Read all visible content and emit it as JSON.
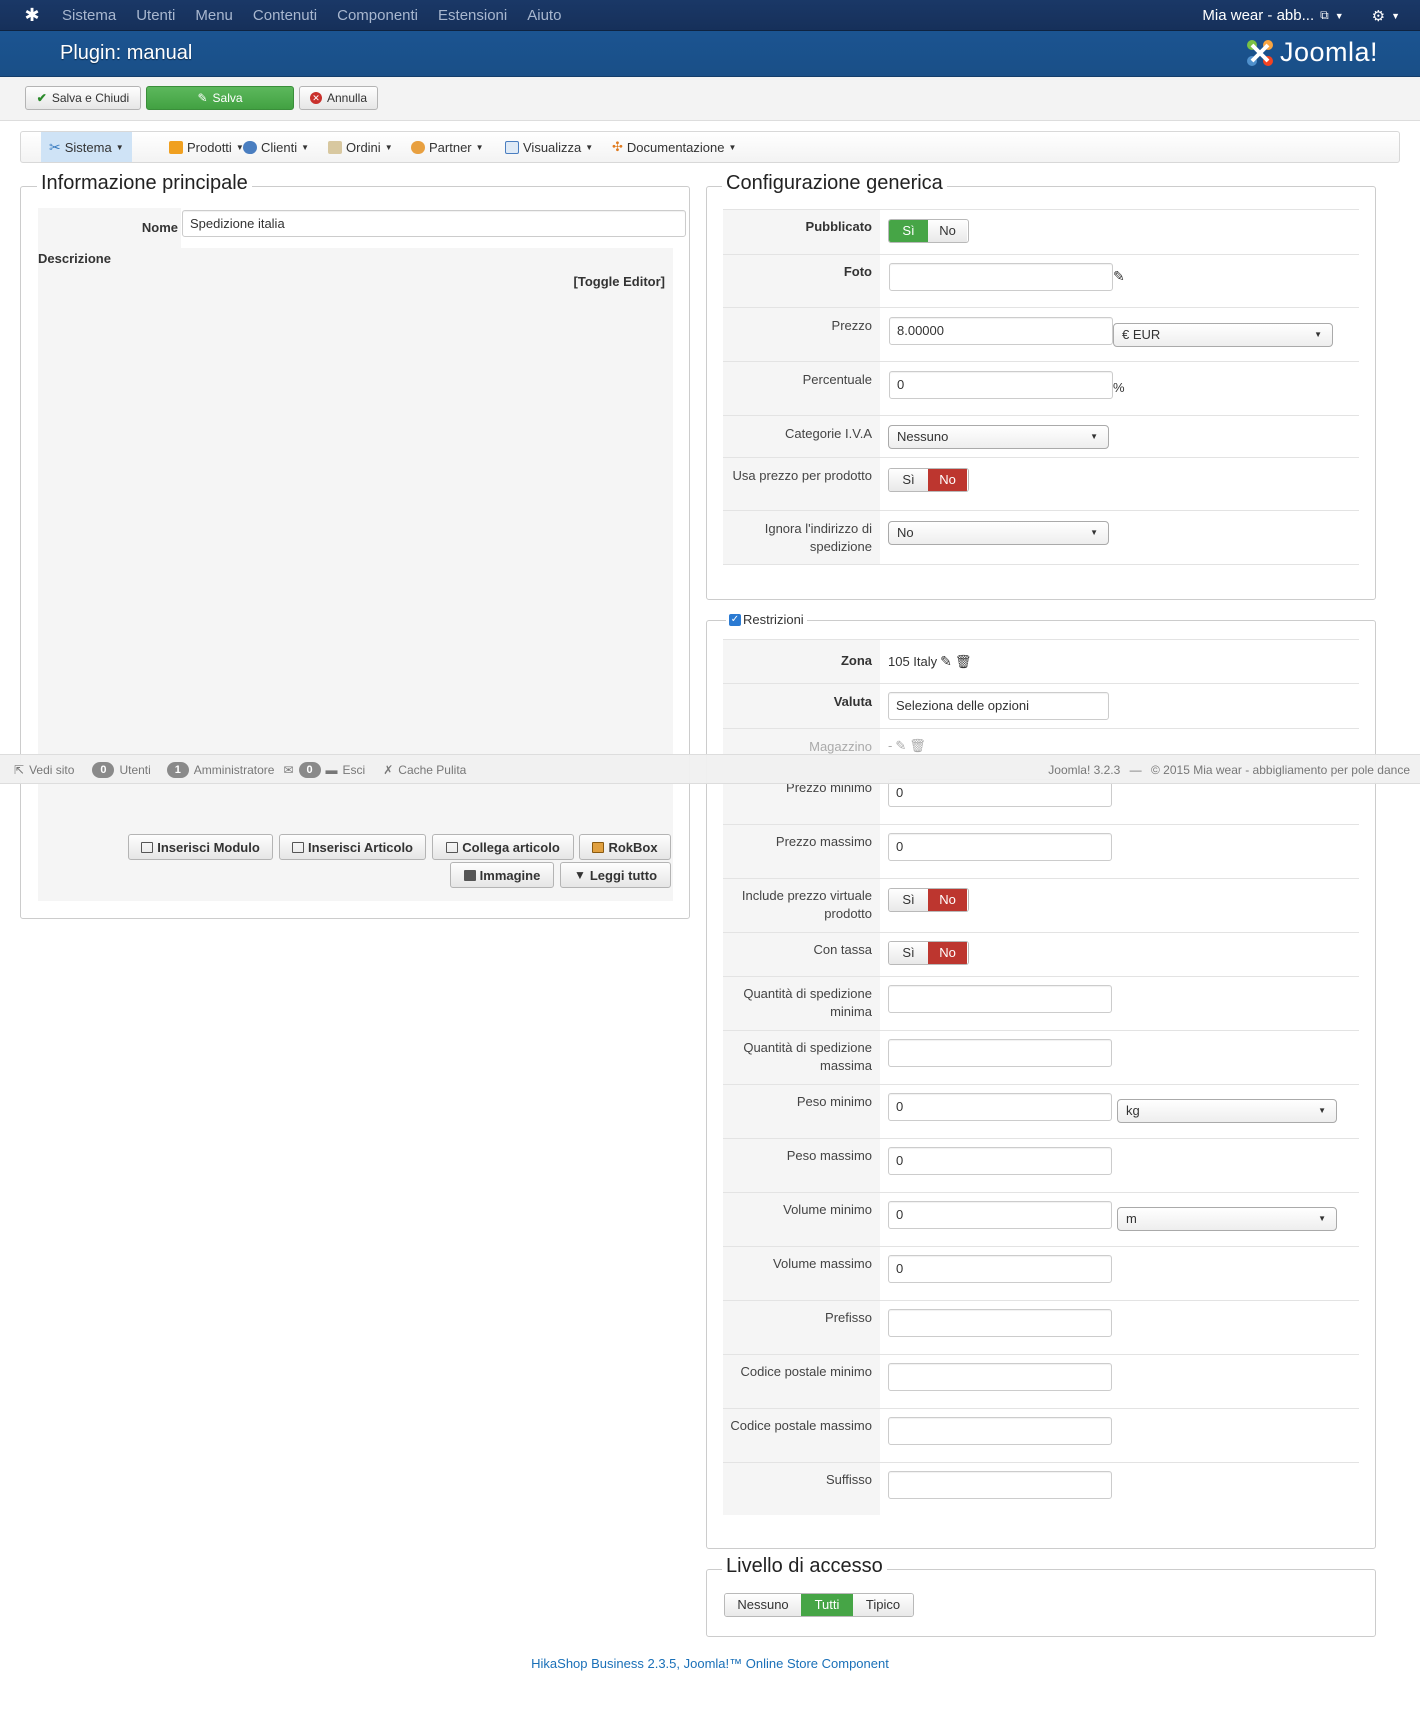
{
  "topbar": {
    "menu": [
      "Sistema",
      "Utenti",
      "Menu",
      "Contenuti",
      "Componenti",
      "Estensioni",
      "Aiuto"
    ],
    "site_name": "Mia wear - abb...",
    "logo_icon": "joomla-icon",
    "gear_icon": "gear-icon"
  },
  "titlebar": {
    "title": "Plugin: manual",
    "brand": "Joomla!"
  },
  "toolbar": {
    "save_close": "Salva e Chiudi",
    "save": "Salva",
    "cancel": "Annulla"
  },
  "hikamenu": [
    "Sistema",
    "Prodotti",
    "Clienti",
    "Ordini",
    "Partner",
    "Visualizza",
    "Documentazione"
  ],
  "main": {
    "legend": "Informazione principale",
    "name_label": "Nome",
    "name_value": "Spedizione italia",
    "description_label": "Descrizione",
    "toggle_editor": "[Toggle Editor]",
    "editor_buttons": [
      "Inserisci Modulo",
      "Inserisci Articolo",
      "Collega articolo",
      "RokBox",
      "Immagine",
      "Leggi tutto"
    ]
  },
  "config": {
    "legend": "Configurazione generica",
    "published_label": "Pubblicato",
    "yes": "Sì",
    "no": "No",
    "photo_label": "Foto",
    "price_label": "Prezzo",
    "price_value": "8.00000",
    "currency": "€ EUR",
    "percent_label": "Percentuale",
    "percent_value": "0",
    "percent_sign": "%",
    "vat_label": "Categorie I.V.A",
    "vat_value": "Nessuno",
    "per_product_label": "Usa prezzo per prodotto",
    "ignore_addr_label": "Ignora l'indirizzo di spedizione",
    "ignore_addr_value": "No"
  },
  "restrictions": {
    "legend": "Restrizioni",
    "zone_label": "Zona",
    "zone_value": "105 Italy",
    "currency_label": "Valuta",
    "currency_placeholder": "Seleziona delle opzioni",
    "warehouse_label": "Magazzino",
    "warehouse_value": "-",
    "rows": [
      {
        "label": "Prezzo minimo",
        "value": "0"
      },
      {
        "label": "Prezzo massimo",
        "value": "0"
      },
      {
        "label": "Include prezzo virtuale prodotto"
      },
      {
        "label": "Con tassa"
      },
      {
        "label": "Quantità di spedizione minima",
        "value": ""
      },
      {
        "label": "Quantità di spedizione massima",
        "value": ""
      },
      {
        "label": "Peso minimo",
        "value": "0",
        "unit": "kg"
      },
      {
        "label": "Peso massimo",
        "value": "0"
      },
      {
        "label": "Volume minimo",
        "value": "0",
        "unit": "m"
      },
      {
        "label": "Volume massimo",
        "value": "0"
      },
      {
        "label": "Prefisso",
        "value": ""
      },
      {
        "label": "Codice postale minimo",
        "value": ""
      },
      {
        "label": "Codice postale massimo",
        "value": ""
      },
      {
        "label": "Suffisso",
        "value": ""
      }
    ]
  },
  "access": {
    "legend": "Livello di accesso",
    "options": [
      "Nessuno",
      "Tutti",
      "Tipico"
    ]
  },
  "statusbar": {
    "view_site": "Vedi sito",
    "users_count": "0",
    "users": "Utenti",
    "admin_count": "1",
    "admin": "Amministratore",
    "msg_count": "0",
    "logout": "Esci",
    "cache": "Cache Pulita",
    "version": "Joomla! 3.2.3",
    "dash": "—",
    "copyright": "© 2015 Mia wear - abbigliamento per pole dance"
  },
  "footer": "HikaShop Business 2.3.5, Joomla!™ Online Store Component",
  "colors": {
    "green": "#46a546",
    "red": "#bd362f",
    "topbar": "#1a3867",
    "titlebar": "#1b5491",
    "link": "#1a70b8"
  }
}
